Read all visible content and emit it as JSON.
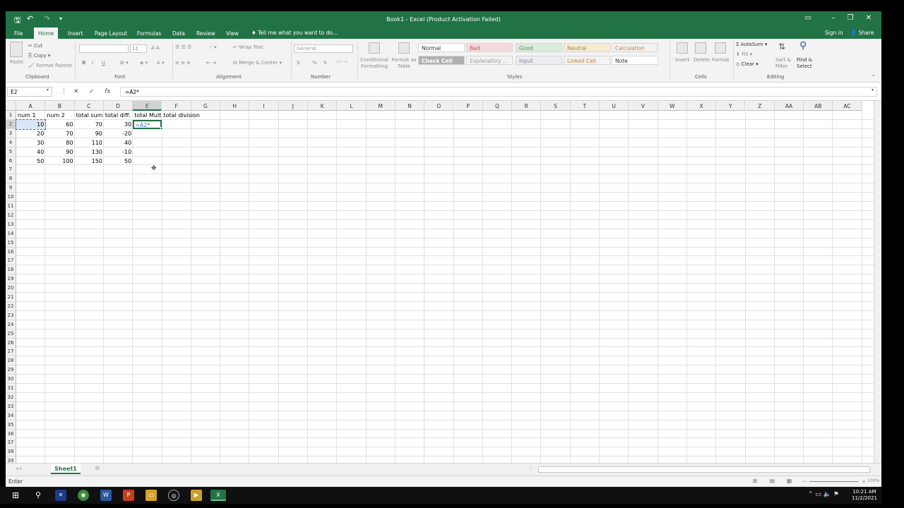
{
  "window": {
    "title": "Book1 - Excel (Product Activation Failed)"
  },
  "quick_access": {
    "save_icon": "save-icon",
    "undo_icon": "undo-icon",
    "redo_icon": "redo-icon"
  },
  "tabs": [
    "File",
    "Home",
    "Insert",
    "Page Layout",
    "Formulas",
    "Data",
    "Review",
    "View"
  ],
  "active_tab": "Home",
  "tell_me": "Tell me what you want to do...",
  "sign_in": "Sign in",
  "share": "Share",
  "ribbon": {
    "clipboard": {
      "paste": "Paste",
      "cut": "Cut",
      "copy": "Copy",
      "format_painter": "Format Painter",
      "label": "Clipboard"
    },
    "font": {
      "bold": "B",
      "italic": "I",
      "underline": "U",
      "size": "11",
      "label": "Font"
    },
    "alignment": {
      "wrap_text": "Wrap Text",
      "merge_center": "Merge & Center",
      "label": "Alignment"
    },
    "number": {
      "format": "General",
      "currency": "$",
      "percent": "%",
      "comma": "9",
      "label": "Number"
    },
    "styles": {
      "conditional_formatting": "Conditional Formatting",
      "format_as_table": "Format as Table",
      "cells": [
        "Normal",
        "Bad",
        "Good",
        "Neutral",
        "Calculation",
        "Check Cell",
        "Explanatory ...",
        "Input",
        "Linked Cell",
        "Note"
      ],
      "label": "Styles"
    },
    "cells": {
      "insert": "Insert",
      "delete": "Delete",
      "format": "Format",
      "label": "Cells"
    },
    "editing": {
      "autosum": "AutoSum",
      "fill": "Fill",
      "clear": "Clear",
      "sort_filter": "Sort & Filter",
      "find_select": "Find & Select",
      "label": "Editing"
    }
  },
  "formula_bar": {
    "name_box": "E2",
    "cancel": "✕",
    "enter": "✓",
    "fx": "fx",
    "formula": "=A2*"
  },
  "columns": [
    "A",
    "B",
    "C",
    "D",
    "E",
    "F",
    "G",
    "H",
    "I",
    "J",
    "K",
    "L",
    "M",
    "N",
    "O",
    "P",
    "Q",
    "R",
    "S",
    "T",
    "U",
    "V",
    "W",
    "X",
    "Y",
    "Z",
    "AA",
    "AB",
    "AC"
  ],
  "selected_column": "E",
  "selected_row": 2,
  "rows": [
    "1",
    "2",
    "3",
    "4",
    "5",
    "6",
    "7",
    "8",
    "9",
    "10",
    "11",
    "12",
    "13",
    "14",
    "15",
    "16",
    "17",
    "18",
    "19",
    "20",
    "21",
    "22",
    "23",
    "24",
    "25",
    "26",
    "27",
    "28",
    "29",
    "30",
    "31",
    "32",
    "33",
    "34",
    "35",
    "36",
    "37",
    "38",
    "39"
  ],
  "sheet": {
    "headers": [
      "num 1",
      "num 2",
      "total sum",
      "total diff.",
      "total Mult",
      "total division"
    ],
    "data": [
      [
        "10",
        "60",
        "70",
        "30"
      ],
      [
        "20",
        "70",
        "90",
        "-20"
      ],
      [
        "30",
        "80",
        "110",
        "40"
      ],
      [
        "40",
        "90",
        "130",
        "-10"
      ],
      [
        "50",
        "100",
        "150",
        "50"
      ]
    ],
    "active_cell_text": "=A2*"
  },
  "sheet_tab": "Sheet1",
  "status": {
    "mode": "Enter",
    "zoom": "100%"
  },
  "taskbar": {
    "time": "10:21 AM",
    "date": "11/2/2021"
  }
}
